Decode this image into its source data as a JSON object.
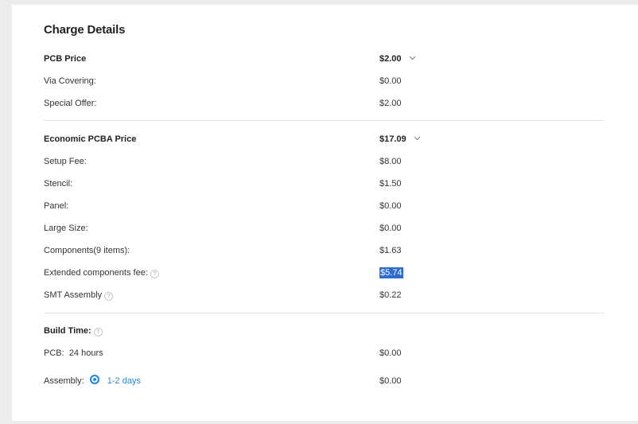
{
  "charge_details": {
    "title": "Charge Details",
    "pcb": {
      "label": "PCB Price",
      "value": "$2.00",
      "items": [
        {
          "label": "Via Covering:",
          "value": "$0.00"
        },
        {
          "label": "Special Offer:",
          "value": "$2.00"
        }
      ]
    },
    "pcba": {
      "label": "Economic PCBA Price",
      "value": "$17.09",
      "items": [
        {
          "label": "Setup Fee:",
          "value": "$8.00"
        },
        {
          "label": "Stencil:",
          "value": "$1.50"
        },
        {
          "label": "Panel:",
          "value": "$0.00"
        },
        {
          "label": "Large Size:",
          "value": "$0.00"
        },
        {
          "label": "Components(9 items):",
          "value": "$1.63"
        },
        {
          "label": "Extended components fee:",
          "value": "$5.74"
        },
        {
          "label": "SMT Assembly",
          "value": "$0.22"
        }
      ]
    },
    "build_time": {
      "label": "Build Time:",
      "pcb_label": "PCB:",
      "pcb_time": "24 hours",
      "pcb_value": "$0.00",
      "assembly_label": "Assembly:",
      "assembly_option": "1-2 days",
      "assembly_value": "$0.00"
    },
    "help_glyph": "?",
    "colors": {
      "accent": "#1e88e5",
      "selection": "#2f6bd0",
      "link": "#2a8ad8"
    }
  }
}
